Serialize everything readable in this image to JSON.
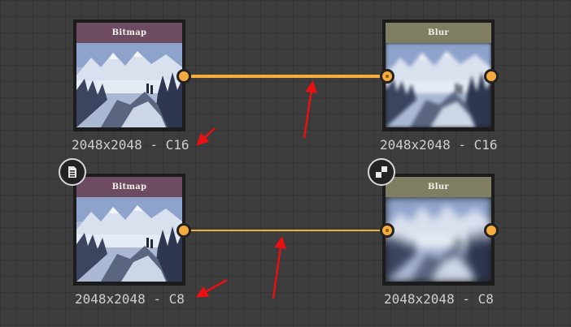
{
  "nodes": {
    "bitmap_top": {
      "title": "Bitmap",
      "resolution": "2048x2048 - C16"
    },
    "blur_top": {
      "title": "Blur",
      "resolution": "2048x2048 - C16"
    },
    "bitmap_bottom": {
      "title": "Bitmap",
      "resolution": "2048x2048 - C8"
    },
    "blur_bottom": {
      "title": "Blur",
      "resolution": "2048x2048 - C8"
    }
  },
  "colors": {
    "bitmap_header": "#6d4b60",
    "blur_header": "#7f7d62",
    "port": "#f5ac3f",
    "wire": "#f5ac3f",
    "annotation_arrow": "#e81010"
  },
  "icons": {
    "bitmap_bottom_badge": "document-icon",
    "blur_bottom_badge": "checker-icon"
  }
}
